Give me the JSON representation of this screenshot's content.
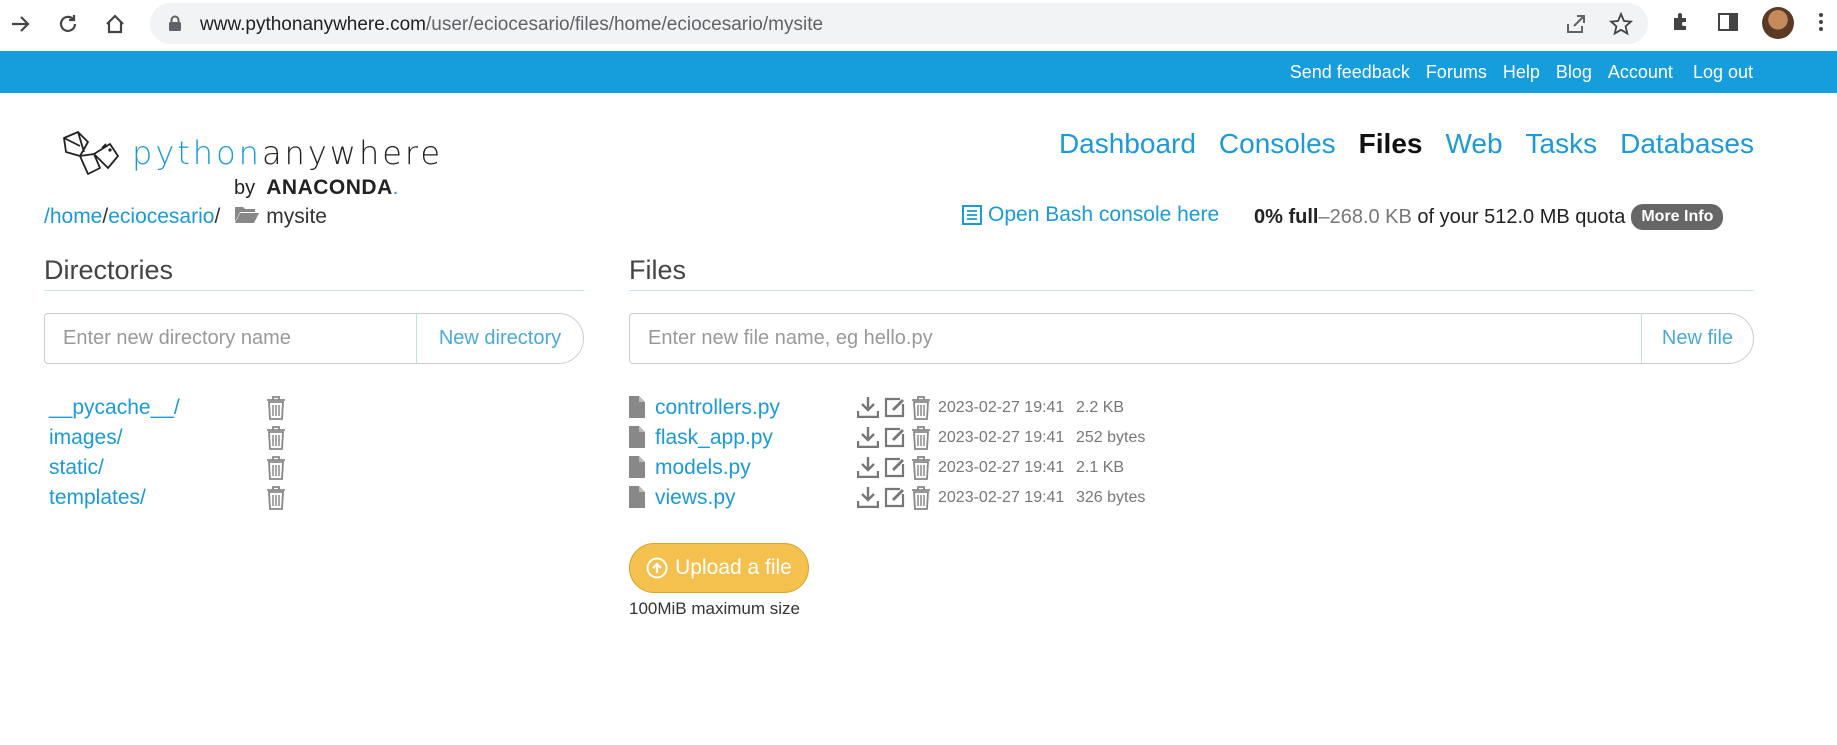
{
  "browser": {
    "url_domain": "www.pythonanywhere.com",
    "url_path": "/user/eciocesario/files/home/eciocesario/mysite"
  },
  "topbar": {
    "links": [
      "Send feedback",
      "Forums",
      "Help",
      "Blog",
      "Account",
      "Log out"
    ]
  },
  "logo": {
    "word1": "python",
    "word2": "anywhere",
    "by": "by",
    "brand": "ANACONDA",
    "brand_dot": "."
  },
  "mainnav": {
    "items": [
      "Dashboard",
      "Consoles",
      "Files",
      "Web",
      "Tasks",
      "Databases"
    ],
    "active": "Files"
  },
  "breadcrumb": {
    "home": "/home",
    "sep1": "/",
    "user": "eciocesario",
    "sep2": "/",
    "current": "mysite"
  },
  "bash_link": "Open Bash console here",
  "quota": {
    "percent": "0% full",
    "dash": " – ",
    "used": "268.0 KB",
    "of_text": " of your 512.0 MB quota",
    "more_info": "More Info"
  },
  "directories": {
    "title": "Directories",
    "placeholder": "Enter new directory name",
    "button": "New directory",
    "items": [
      "__pycache__/",
      "images/",
      "static/",
      "templates/"
    ]
  },
  "files": {
    "title": "Files",
    "placeholder": "Enter new file name, eg hello.py",
    "button": "New file",
    "items": [
      {
        "name": "controllers.py",
        "date": "2023-02-27 19:41",
        "size": "2.2 KB"
      },
      {
        "name": "flask_app.py",
        "date": "2023-02-27 19:41",
        "size": "252 bytes"
      },
      {
        "name": "models.py",
        "date": "2023-02-27 19:41",
        "size": "2.1 KB"
      },
      {
        "name": "views.py",
        "date": "2023-02-27 19:41",
        "size": "326 bytes"
      }
    ]
  },
  "upload": {
    "label": "Upload a file",
    "note": "100MiB maximum size"
  },
  "colors": {
    "brand_blue": "#159ddc",
    "link_blue": "#1b9ad6",
    "upload_yellow": "#f4c14e"
  }
}
